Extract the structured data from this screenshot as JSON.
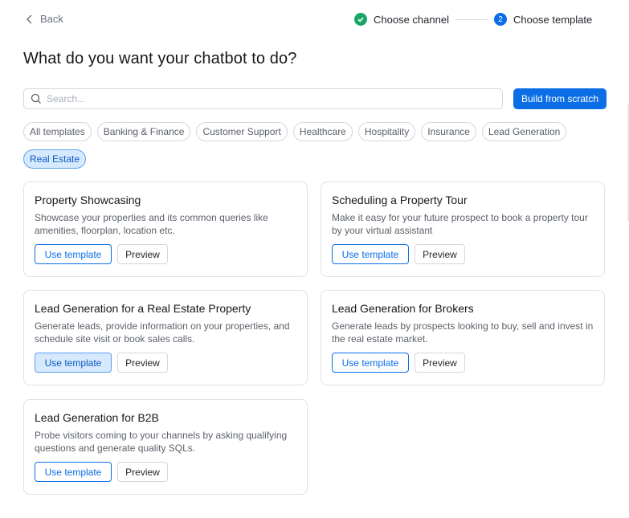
{
  "nav": {
    "back_label": "Back"
  },
  "stepper": {
    "steps": [
      {
        "label": "Choose channel",
        "status": "done"
      },
      {
        "label": "Choose template",
        "status": "current",
        "number": "2"
      }
    ]
  },
  "heading": "What do you want your chatbot to do?",
  "search": {
    "placeholder": "Search...",
    "value": ""
  },
  "build_button": "Build from scratch",
  "chips": [
    {
      "label": "All templates",
      "active": false
    },
    {
      "label": "Banking & Finance",
      "active": false
    },
    {
      "label": "Customer Support",
      "active": false
    },
    {
      "label": "Healthcare",
      "active": false
    },
    {
      "label": "Hospitality",
      "active": false
    },
    {
      "label": "Insurance",
      "active": false
    },
    {
      "label": "Lead Generation",
      "active": false
    },
    {
      "label": "Real Estate",
      "active": true
    }
  ],
  "card_actions": {
    "use_label": "Use template",
    "preview_label": "Preview"
  },
  "cards": [
    {
      "title": "Property Showcasing",
      "description": "Showcase your properties and its common queries like amenities, floorplan, location etc."
    },
    {
      "title": "Scheduling a Property Tour",
      "description": "Make it easy for your future prospect to book a property tour by your virtual assistant"
    },
    {
      "title": "Lead Generation for a Real Estate Property",
      "description": "Generate leads, provide information on your properties, and schedule site visit or book sales calls."
    },
    {
      "title": "Lead Generation for Brokers",
      "description": "Generate leads by prospects looking to buy, sell and invest in the real estate market."
    },
    {
      "title": "Lead Generation for B2B",
      "description": "Probe visitors coming to your channels by asking qualifying questions and generate quality SQLs."
    }
  ],
  "colors": {
    "primary": "#0b6ee6",
    "success": "#1aa765",
    "chip_active_bg": "#d7e9fd"
  },
  "icons": {
    "back": "chevron-left-icon",
    "done": "check-icon",
    "search": "search-icon"
  }
}
